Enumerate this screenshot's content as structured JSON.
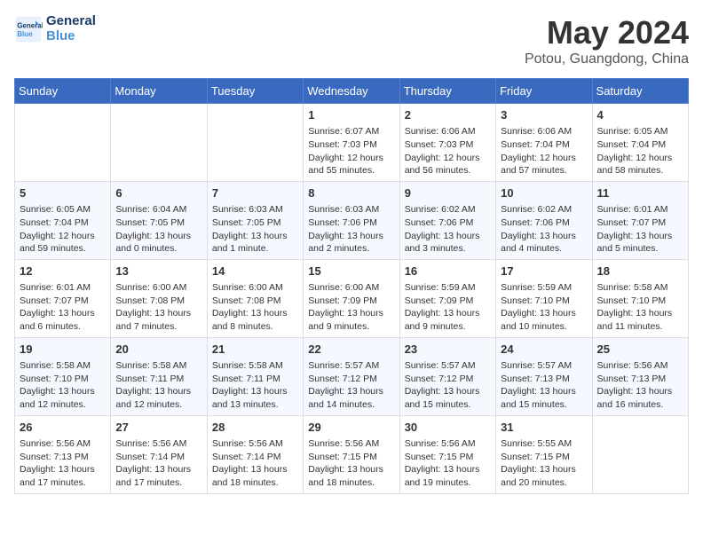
{
  "header": {
    "logo_line1": "General",
    "logo_line2": "Blue",
    "month": "May 2024",
    "location": "Potou, Guangdong, China"
  },
  "days_of_week": [
    "Sunday",
    "Monday",
    "Tuesday",
    "Wednesday",
    "Thursday",
    "Friday",
    "Saturday"
  ],
  "weeks": [
    [
      {
        "day": "",
        "info": ""
      },
      {
        "day": "",
        "info": ""
      },
      {
        "day": "",
        "info": ""
      },
      {
        "day": "1",
        "info": "Sunrise: 6:07 AM\nSunset: 7:03 PM\nDaylight: 12 hours\nand 55 minutes."
      },
      {
        "day": "2",
        "info": "Sunrise: 6:06 AM\nSunset: 7:03 PM\nDaylight: 12 hours\nand 56 minutes."
      },
      {
        "day": "3",
        "info": "Sunrise: 6:06 AM\nSunset: 7:04 PM\nDaylight: 12 hours\nand 57 minutes."
      },
      {
        "day": "4",
        "info": "Sunrise: 6:05 AM\nSunset: 7:04 PM\nDaylight: 12 hours\nand 58 minutes."
      }
    ],
    [
      {
        "day": "5",
        "info": "Sunrise: 6:05 AM\nSunset: 7:04 PM\nDaylight: 12 hours\nand 59 minutes."
      },
      {
        "day": "6",
        "info": "Sunrise: 6:04 AM\nSunset: 7:05 PM\nDaylight: 13 hours\nand 0 minutes."
      },
      {
        "day": "7",
        "info": "Sunrise: 6:03 AM\nSunset: 7:05 PM\nDaylight: 13 hours\nand 1 minute."
      },
      {
        "day": "8",
        "info": "Sunrise: 6:03 AM\nSunset: 7:06 PM\nDaylight: 13 hours\nand 2 minutes."
      },
      {
        "day": "9",
        "info": "Sunrise: 6:02 AM\nSunset: 7:06 PM\nDaylight: 13 hours\nand 3 minutes."
      },
      {
        "day": "10",
        "info": "Sunrise: 6:02 AM\nSunset: 7:06 PM\nDaylight: 13 hours\nand 4 minutes."
      },
      {
        "day": "11",
        "info": "Sunrise: 6:01 AM\nSunset: 7:07 PM\nDaylight: 13 hours\nand 5 minutes."
      }
    ],
    [
      {
        "day": "12",
        "info": "Sunrise: 6:01 AM\nSunset: 7:07 PM\nDaylight: 13 hours\nand 6 minutes."
      },
      {
        "day": "13",
        "info": "Sunrise: 6:00 AM\nSunset: 7:08 PM\nDaylight: 13 hours\nand 7 minutes."
      },
      {
        "day": "14",
        "info": "Sunrise: 6:00 AM\nSunset: 7:08 PM\nDaylight: 13 hours\nand 8 minutes."
      },
      {
        "day": "15",
        "info": "Sunrise: 6:00 AM\nSunset: 7:09 PM\nDaylight: 13 hours\nand 9 minutes."
      },
      {
        "day": "16",
        "info": "Sunrise: 5:59 AM\nSunset: 7:09 PM\nDaylight: 13 hours\nand 9 minutes."
      },
      {
        "day": "17",
        "info": "Sunrise: 5:59 AM\nSunset: 7:10 PM\nDaylight: 13 hours\nand 10 minutes."
      },
      {
        "day": "18",
        "info": "Sunrise: 5:58 AM\nSunset: 7:10 PM\nDaylight: 13 hours\nand 11 minutes."
      }
    ],
    [
      {
        "day": "19",
        "info": "Sunrise: 5:58 AM\nSunset: 7:10 PM\nDaylight: 13 hours\nand 12 minutes."
      },
      {
        "day": "20",
        "info": "Sunrise: 5:58 AM\nSunset: 7:11 PM\nDaylight: 13 hours\nand 12 minutes."
      },
      {
        "day": "21",
        "info": "Sunrise: 5:58 AM\nSunset: 7:11 PM\nDaylight: 13 hours\nand 13 minutes."
      },
      {
        "day": "22",
        "info": "Sunrise: 5:57 AM\nSunset: 7:12 PM\nDaylight: 13 hours\nand 14 minutes."
      },
      {
        "day": "23",
        "info": "Sunrise: 5:57 AM\nSunset: 7:12 PM\nDaylight: 13 hours\nand 15 minutes."
      },
      {
        "day": "24",
        "info": "Sunrise: 5:57 AM\nSunset: 7:13 PM\nDaylight: 13 hours\nand 15 minutes."
      },
      {
        "day": "25",
        "info": "Sunrise: 5:56 AM\nSunset: 7:13 PM\nDaylight: 13 hours\nand 16 minutes."
      }
    ],
    [
      {
        "day": "26",
        "info": "Sunrise: 5:56 AM\nSunset: 7:13 PM\nDaylight: 13 hours\nand 17 minutes."
      },
      {
        "day": "27",
        "info": "Sunrise: 5:56 AM\nSunset: 7:14 PM\nDaylight: 13 hours\nand 17 minutes."
      },
      {
        "day": "28",
        "info": "Sunrise: 5:56 AM\nSunset: 7:14 PM\nDaylight: 13 hours\nand 18 minutes."
      },
      {
        "day": "29",
        "info": "Sunrise: 5:56 AM\nSunset: 7:15 PM\nDaylight: 13 hours\nand 18 minutes."
      },
      {
        "day": "30",
        "info": "Sunrise: 5:56 AM\nSunset: 7:15 PM\nDaylight: 13 hours\nand 19 minutes."
      },
      {
        "day": "31",
        "info": "Sunrise: 5:55 AM\nSunset: 7:15 PM\nDaylight: 13 hours\nand 20 minutes."
      },
      {
        "day": "",
        "info": ""
      }
    ]
  ]
}
